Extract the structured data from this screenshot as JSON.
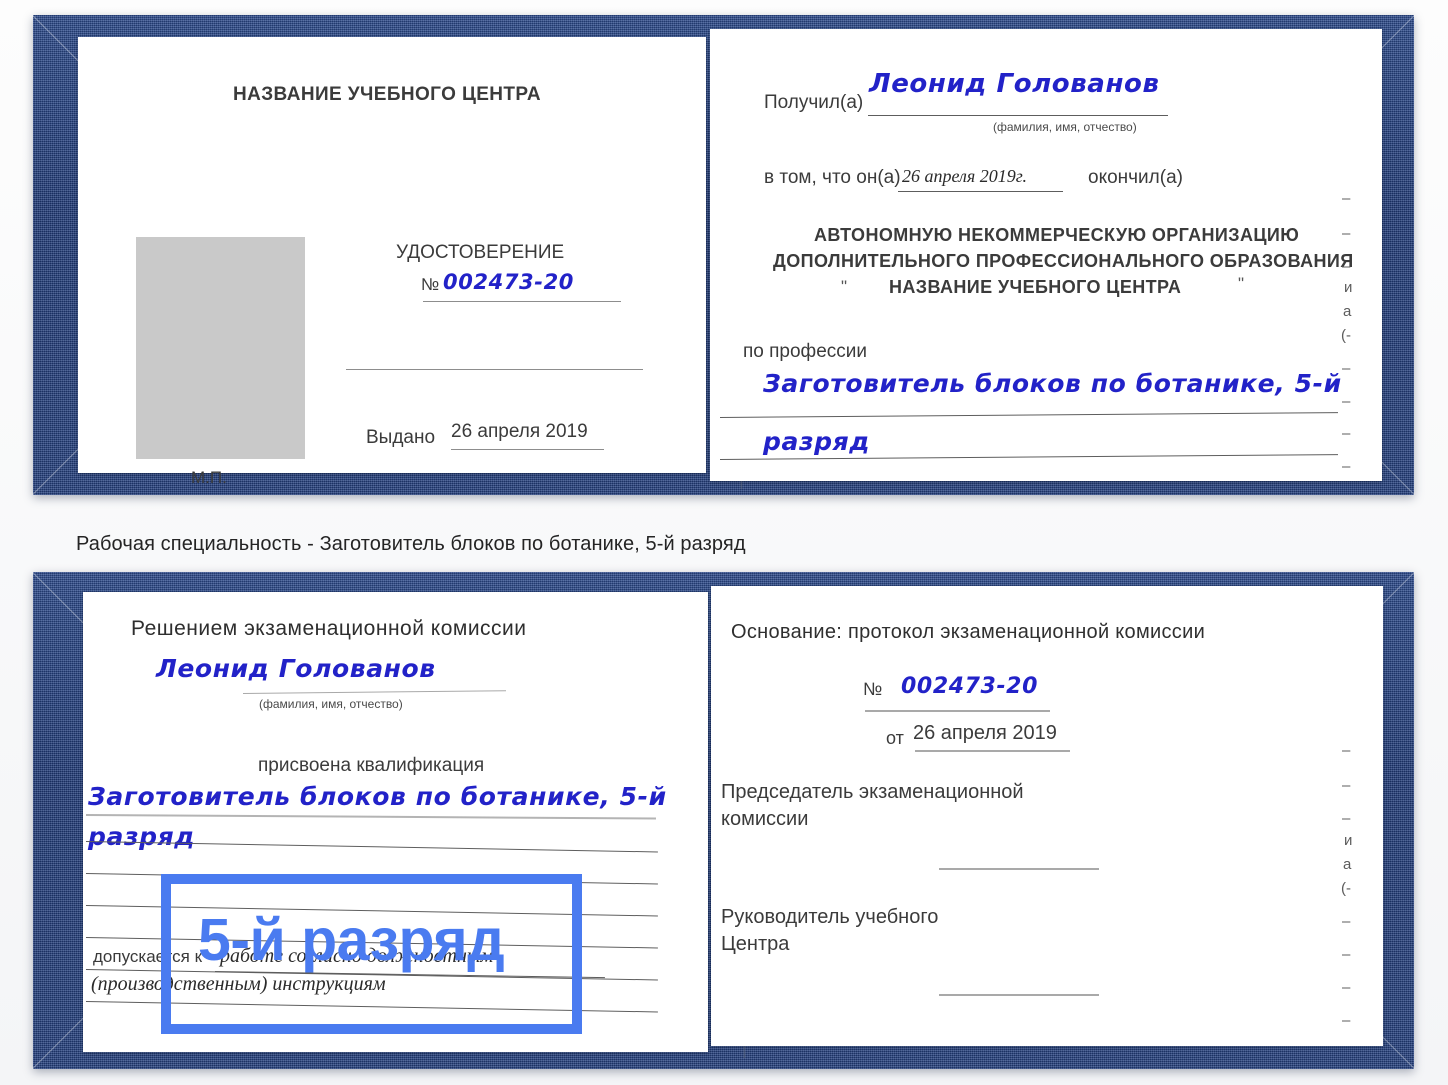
{
  "caption": "Рабочая специальность - Заготовитель блоков по ботанике, 5-й разряд",
  "colors": {
    "cover_blue": "#24407f",
    "ink_blue": "#2222c8",
    "highlight_blue": "#4a7bf0",
    "paper_white": "#ffffff",
    "photo_grey": "#c9c9c9"
  },
  "highlight": {
    "label": "5-й разряд"
  },
  "certificate_top": {
    "left_page": {
      "org_title": "НАЗВАНИЕ УЧЕБНОГО ЦЕНТРА",
      "doc_type": "УДОСТОВЕРЕНИЕ",
      "number_label": "№",
      "number_value": "002473-20",
      "issued_label": "Выдано",
      "issued_value": "26 апреля 2019",
      "seal_label": "М.П."
    },
    "right_page": {
      "received_label": "Получил(а)",
      "received_value": "Леонид Голованов",
      "fio_hint": "(фамилия, имя, отчество)",
      "in_that_label": "в том, что он(а)",
      "completion_date": "26 апреля 2019г.",
      "finished_label": "окончил(а)",
      "org_line1": "АВТОНОМНУЮ НЕКОММЕРЧЕСКУЮ ОРГАНИЗАЦИЮ",
      "org_line2": "ДОПОЛНИТЕЛЬНОГО ПРОФЕССИОНАЛЬНОГО ОБРАЗОВАНИЯ",
      "org_quote_open": "\"",
      "org_line3": "НАЗВАНИЕ УЧЕБНОГО ЦЕНТРА",
      "org_quote_close": "\"",
      "profession_label": "по профессии",
      "profession_value_line1": "Заготовитель блоков по ботанике, 5-й",
      "profession_value_line2": "разряд",
      "margin_glyphs": [
        "–",
        "–",
        "–",
        "и",
        "а",
        "(-",
        "–",
        "–",
        "–"
      ]
    }
  },
  "certificate_bottom": {
    "left_page": {
      "decision_title": "Решением экзаменационной комиссии",
      "name_value": "Леонид Голованов",
      "fio_hint": "(фамилия, имя, отчество)",
      "qualification_label": "присвоена квалификация",
      "qualification_line1": "Заготовитель блоков по ботанике, 5-й",
      "qualification_line2": "разряд",
      "admitted_label": "допускается к",
      "admitted_value_line1": "работе согласно должностным",
      "admitted_value_line2": "(производственным) инструкциям"
    },
    "right_page": {
      "basis_label": "Основание: протокол экзаменационной комиссии",
      "number_label": "№",
      "number_value": "002473-20",
      "from_label": "от",
      "from_value": "26 апреля 2019",
      "chairman_line1": "Председатель экзаменационной",
      "chairman_line2": "комиссии",
      "head_line1": "Руководитель учебного",
      "head_line2": "Центра",
      "margin_glyphs": [
        "–",
        "–",
        "–",
        "и",
        "а",
        "(-",
        "–",
        "–",
        "–"
      ]
    }
  }
}
